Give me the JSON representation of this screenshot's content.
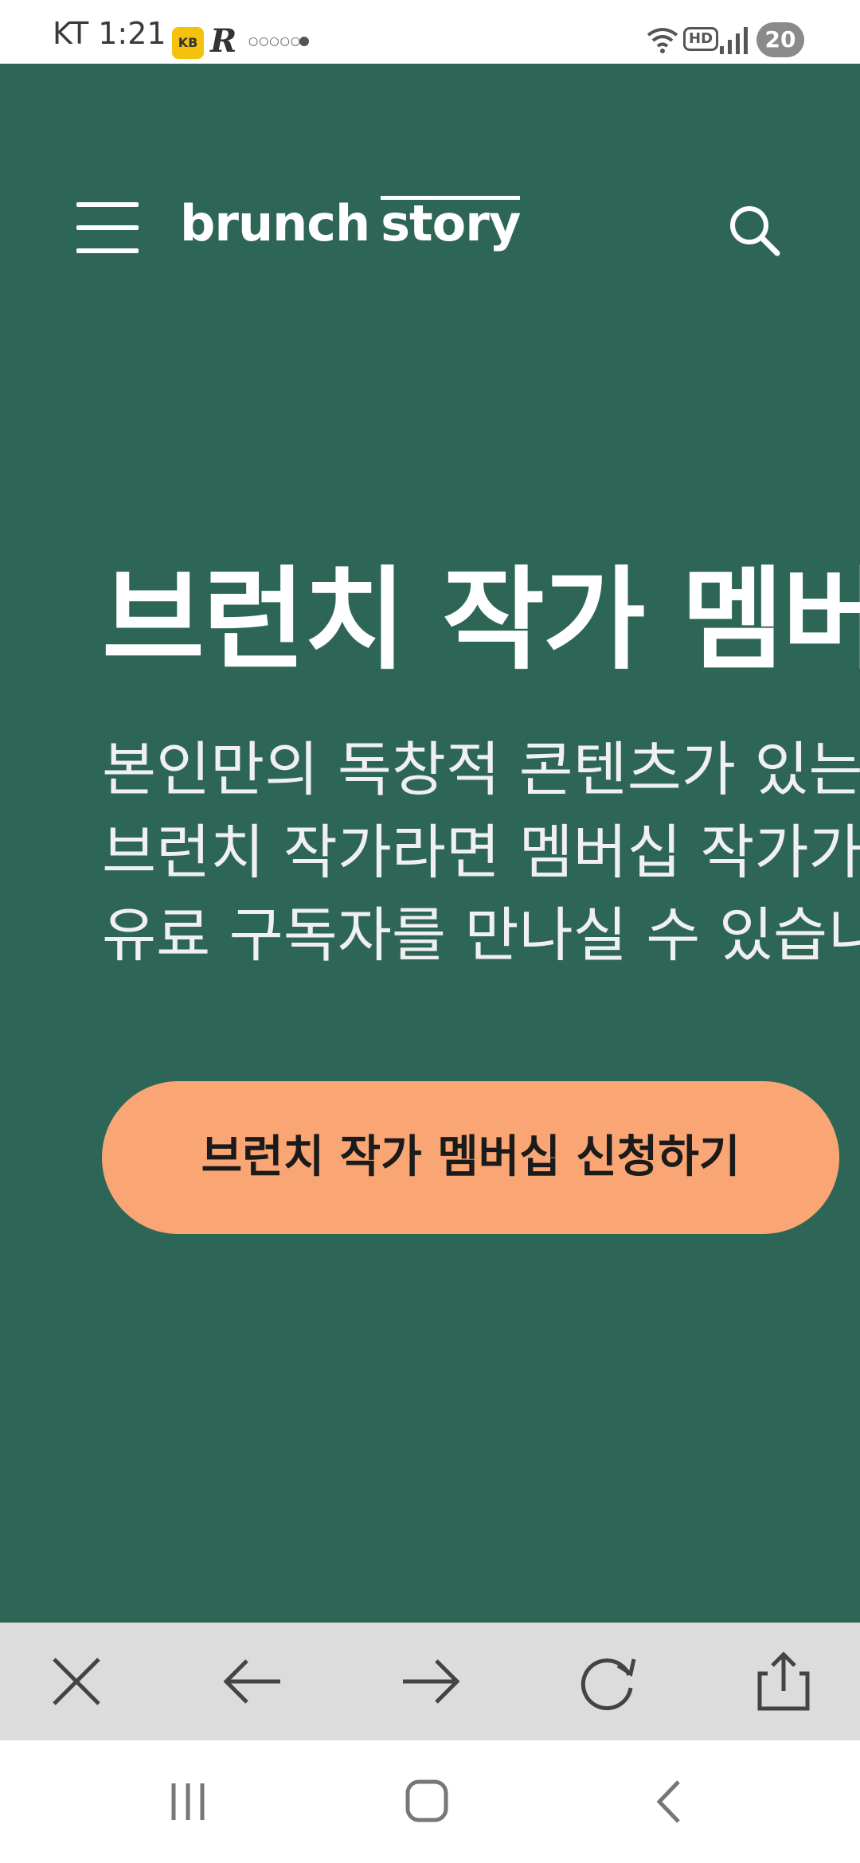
{
  "status_bar": {
    "carrier_time": "KT 1:21",
    "notification_app_badge": "KB",
    "notification_r": "R",
    "notification_ring": "○○○○○",
    "hd_label": "HD",
    "battery": "20"
  },
  "header": {
    "logo_part1": "brunch",
    "logo_part2": "story",
    "menu_icon": "hamburger-menu-icon",
    "search_icon": "search-icon"
  },
  "hero": {
    "headline": "브런치 작가 멤버십",
    "description_lines": [
      "본인만의 독창적 콘텐츠가 있는",
      "브런치 작가라면 멤버십 작가가",
      "유료 구독자를 만나실 수 있습니"
    ],
    "cta_label": "브런치 작가 멤버십 신청하기",
    "background_color": "#2d6657",
    "cta_color": "#faa674"
  },
  "toolbar": {
    "icons": [
      "close-icon",
      "back-arrow-icon",
      "forward-arrow-icon",
      "reload-icon",
      "share-icon"
    ]
  },
  "navbar": {
    "icons": [
      "recent-apps-icon",
      "home-icon",
      "nav-back-icon"
    ]
  }
}
